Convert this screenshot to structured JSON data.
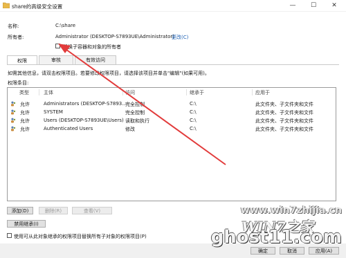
{
  "window": {
    "title": "share的高级安全设置",
    "minimize": "—",
    "maximize": "☐",
    "close": "✕"
  },
  "info": {
    "name_label": "名称:",
    "name_value": "C:\\share",
    "owner_label": "所有者:",
    "owner_value": "Administrator (DESKTOP-S7893UE\\Administrator)",
    "change_link": "更改(C)",
    "replace_owner_checkbox": "替换子容器和对象的所有者",
    "replace_owner_checked": false
  },
  "tabs": [
    {
      "label": "权限",
      "active": true
    },
    {
      "label": "审核",
      "active": false
    },
    {
      "label": "有效访问",
      "active": false
    }
  ],
  "description": "如需其他信息，请双击权限项目。若要修改权限项目，请选择该项目并单击\"编辑\"(如果可用)。",
  "entries_label": "权限条目:",
  "table": {
    "columns": [
      "类型",
      "主体",
      "访问",
      "继承于",
      "应用于"
    ],
    "rows": [
      {
        "type": "允许",
        "principal": "Administrators (DESKTOP-S7893...",
        "access": "完全控制",
        "inherited": "C:\\",
        "applies": "此文件夹、子文件夹和文件"
      },
      {
        "type": "允许",
        "principal": "SYSTEM",
        "access": "完全控制",
        "inherited": "C:\\",
        "applies": "此文件夹、子文件夹和文件"
      },
      {
        "type": "允许",
        "principal": "Users (DESKTOP-S7893UE\\Users)",
        "access": "读取和执行",
        "inherited": "C:\\",
        "applies": "此文件夹、子文件夹和文件"
      },
      {
        "type": "允许",
        "principal": "Authenticated Users",
        "access": "修改",
        "inherited": "C:\\",
        "applies": "此文件夹、子文件夹和文件"
      }
    ]
  },
  "buttons": {
    "add": "添加(D)",
    "remove": "删除(R)",
    "view": "查看(V)",
    "disable_inheritance": "禁用继承(I)",
    "ok": "确定",
    "cancel": "取消",
    "apply": "应用(A)"
  },
  "replace_child_checkbox": "使用可从此对象继承的权限项目替换所有子对象的权限项目(P)",
  "replace_child_checked": false,
  "watermarks": {
    "top": "www.win7zhijia.cn",
    "logo": "WIN7之家",
    "bottom": "ghost11.com"
  },
  "colors": {
    "arrow": "#e23b3b",
    "link": "#1a5fb4"
  }
}
